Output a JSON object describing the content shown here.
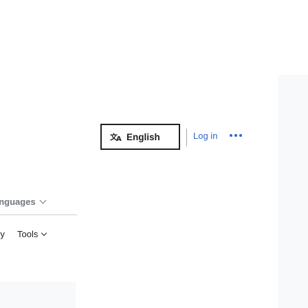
{
  "header": {
    "language_button_label": "English",
    "login_label": "Log in"
  },
  "sidebar": {
    "languages_label": "anguages",
    "history_fragment": "ry",
    "tools_label": "Tools"
  },
  "icons": {
    "language": "translate-icon",
    "more": "ellipsis-icon",
    "chevron": "chevron-down-icon"
  },
  "colors": {
    "link": "#3366cc",
    "text": "#202122",
    "muted": "#72777d",
    "panel": "#f8f9fa"
  }
}
